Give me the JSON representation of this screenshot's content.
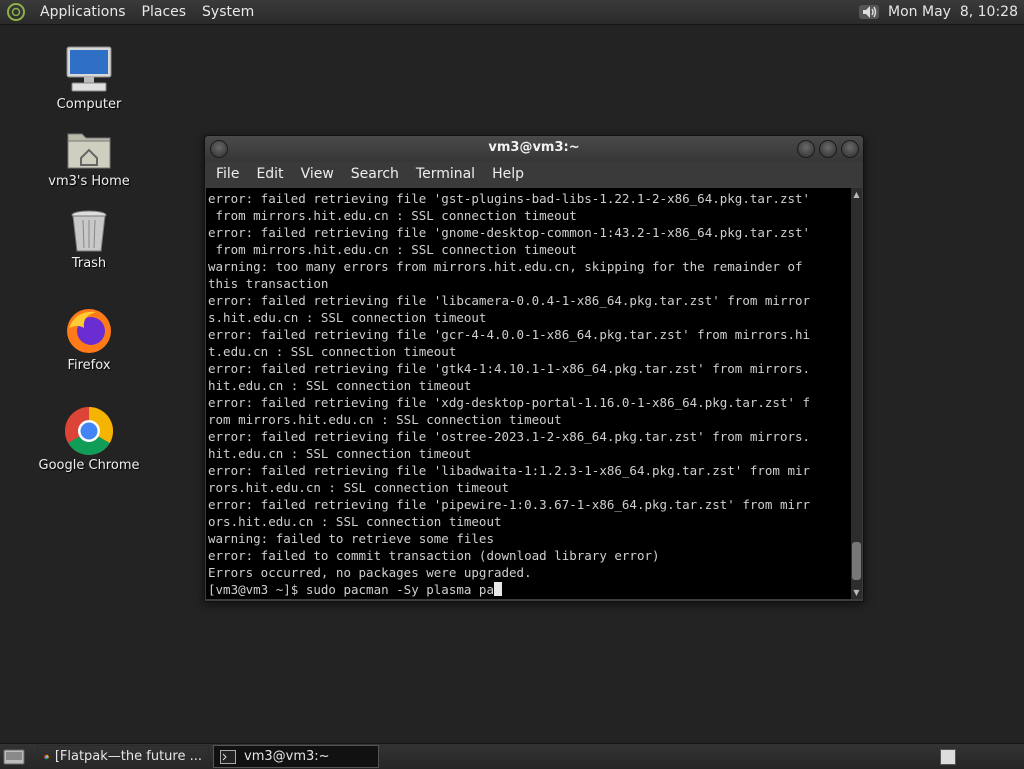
{
  "top_panel": {
    "menus": [
      "Applications",
      "Places",
      "System"
    ],
    "clock": "Mon May  8, 10:28"
  },
  "desktop": {
    "icons": [
      {
        "label": "Computer",
        "icon": "computer-icon"
      },
      {
        "label": "vm3's Home",
        "icon": "home-folder-icon"
      },
      {
        "label": "Trash",
        "icon": "trash-icon"
      },
      {
        "label": "Firefox",
        "icon": "firefox-icon"
      },
      {
        "label": "Google Chrome",
        "icon": "chrome-icon"
      }
    ]
  },
  "terminal": {
    "title": "vm3@vm3:~",
    "menu": [
      "File",
      "Edit",
      "View",
      "Search",
      "Terminal",
      "Help"
    ],
    "lines": [
      "error: failed retrieving file 'gst-plugins-bad-libs-1.22.1-2-x86_64.pkg.tar.zst'",
      " from mirrors.hit.edu.cn : SSL connection timeout",
      "error: failed retrieving file 'gnome-desktop-common-1:43.2-1-x86_64.pkg.tar.zst'",
      " from mirrors.hit.edu.cn : SSL connection timeout",
      "warning: too many errors from mirrors.hit.edu.cn, skipping for the remainder of",
      "this transaction",
      "error: failed retrieving file 'libcamera-0.0.4-1-x86_64.pkg.tar.zst' from mirror",
      "s.hit.edu.cn : SSL connection timeout",
      "error: failed retrieving file 'gcr-4-4.0.0-1-x86_64.pkg.tar.zst' from mirrors.hi",
      "t.edu.cn : SSL connection timeout",
      "error: failed retrieving file 'gtk4-1:4.10.1-1-x86_64.pkg.tar.zst' from mirrors.",
      "hit.edu.cn : SSL connection timeout",
      "error: failed retrieving file 'xdg-desktop-portal-1.16.0-1-x86_64.pkg.tar.zst' f",
      "rom mirrors.hit.edu.cn : SSL connection timeout",
      "error: failed retrieving file 'ostree-2023.1-2-x86_64.pkg.tar.zst' from mirrors.",
      "hit.edu.cn : SSL connection timeout",
      "error: failed retrieving file 'libadwaita-1:1.2.3-1-x86_64.pkg.tar.zst' from mir",
      "rors.hit.edu.cn : SSL connection timeout",
      "error: failed retrieving file 'pipewire-1:0.3.67-1-x86_64.pkg.tar.zst' from mirr",
      "ors.hit.edu.cn : SSL connection timeout",
      "warning: failed to retrieve some files",
      "error: failed to commit transaction (download library error)",
      "Errors occurred, no packages were upgraded."
    ],
    "prompt": "[vm3@vm3 ~]$ sudo pacman -Sy plasma pa"
  },
  "taskbar": {
    "tasks": [
      {
        "label": "[Flatpak—the future ...",
        "icon": "chrome-icon"
      },
      {
        "label": "vm3@vm3:~",
        "icon": "terminal-icon"
      }
    ]
  }
}
